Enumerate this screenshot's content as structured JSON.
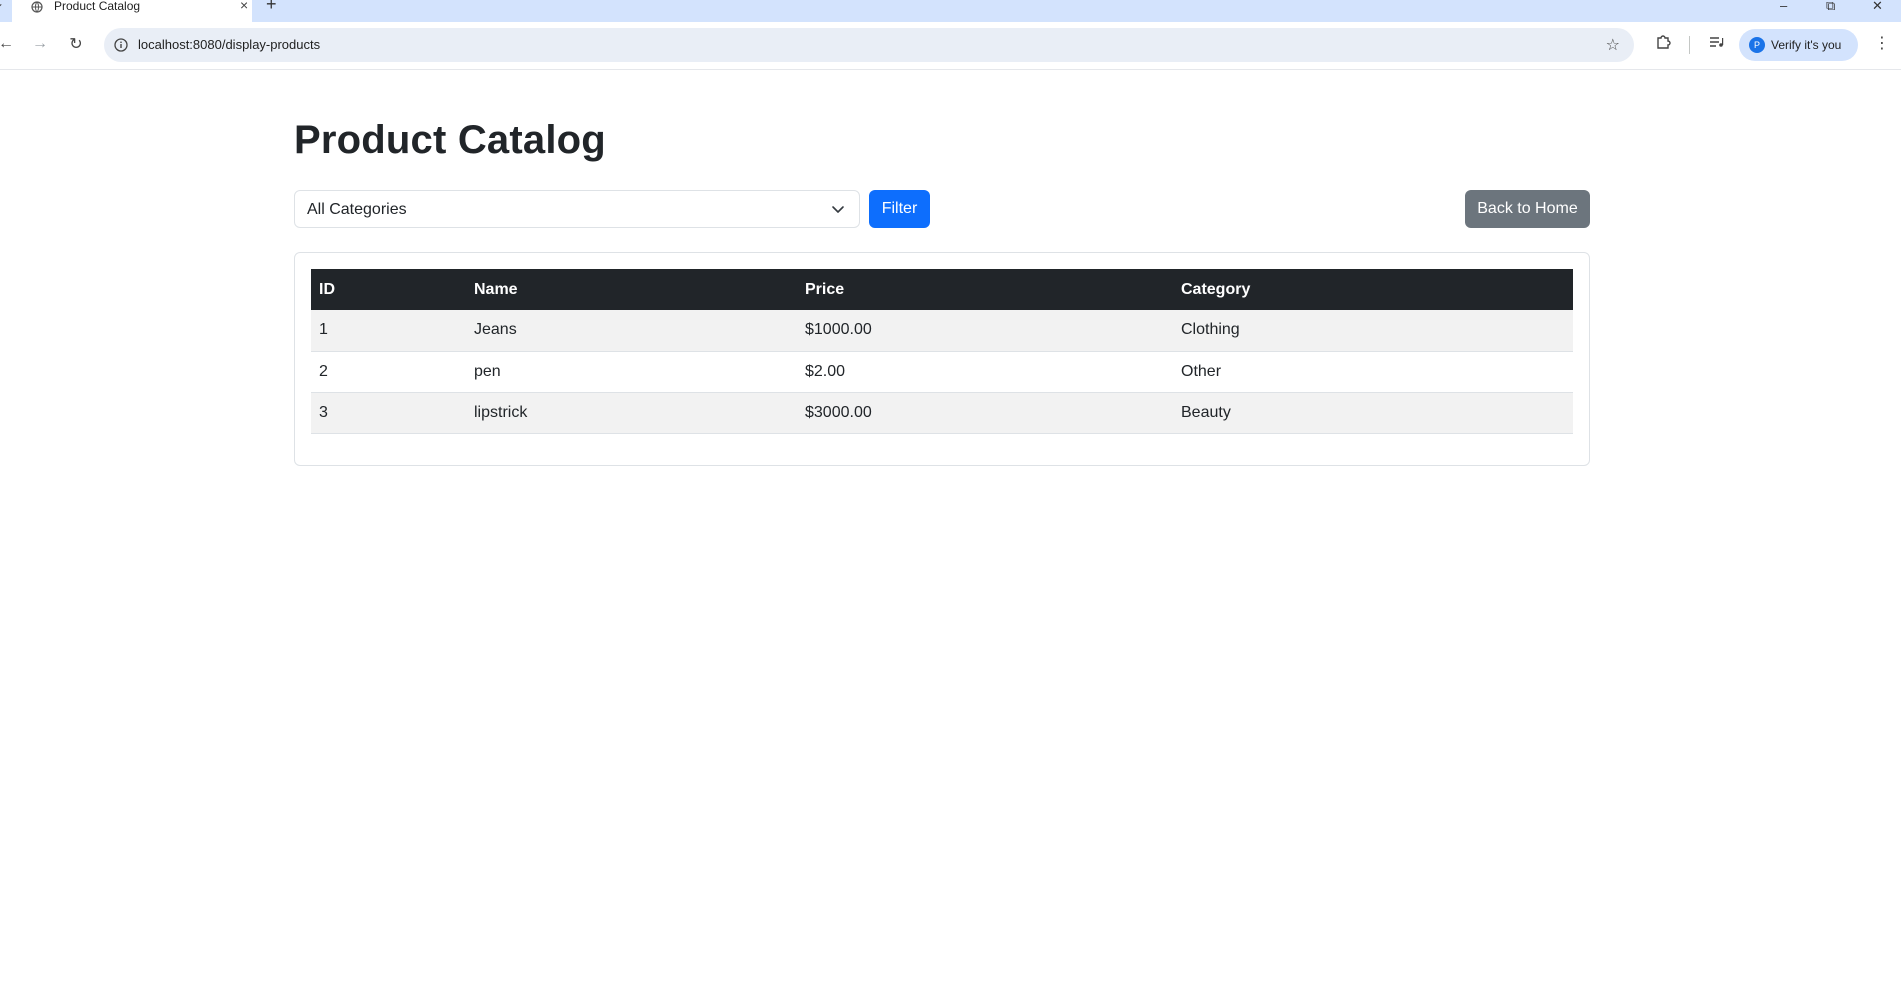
{
  "browser": {
    "tab": {
      "title": "Product Catalog",
      "favicon": "globe-icon",
      "close_icon": "close-icon"
    },
    "new_tab_icon": "plus-icon",
    "window_controls": [
      "minimize-icon",
      "restore-icon",
      "close-icon"
    ],
    "address_bar": {
      "url": "localhost:8080/display-products",
      "site_info_icon": "info-icon",
      "bookmark_icon": "star-icon"
    },
    "extensions_icon": "puzzle-icon",
    "media_icon": "media-queue-icon",
    "profile": {
      "initial": "P",
      "label": "Verify it's you"
    },
    "menu_icon": "kebab-menu-icon"
  },
  "page": {
    "title": "Product Catalog",
    "filter": {
      "selected": "All Categories",
      "button_label": "Filter"
    },
    "back_button_label": "Back to Home",
    "table": {
      "columns": [
        "ID",
        "Name",
        "Price",
        "Category"
      ],
      "rows": [
        {
          "id": "1",
          "name": "Jeans",
          "price": "$1000.00",
          "category": "Clothing"
        },
        {
          "id": "2",
          "name": "pen",
          "price": "$2.00",
          "category": "Other"
        },
        {
          "id": "3",
          "name": "lipstrick",
          "price": "$3000.00",
          "category": "Beauty"
        }
      ]
    }
  },
  "colors": {
    "primary": "#0d6efd",
    "secondary": "#6c757d",
    "table_header": "#212529",
    "striped_row": "#f2f2f2",
    "tabstrip": "#d3e3fd"
  }
}
